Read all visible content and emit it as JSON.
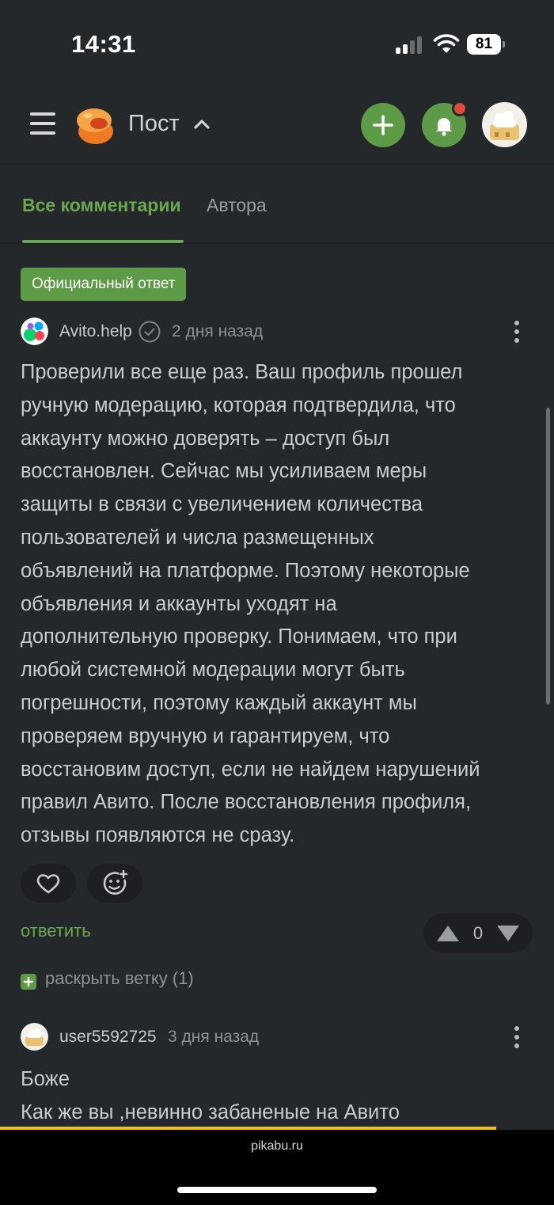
{
  "status_bar": {
    "time": "14:31",
    "battery": "81"
  },
  "header": {
    "title": "Пост"
  },
  "tabs": {
    "all": "Все комментарии",
    "author": "Автора"
  },
  "comment1": {
    "badge": "Официальный ответ",
    "author": "Avito.help",
    "time": "2 дня назад",
    "lines": [
      "Проверили все еще раз. Ваш профиль прошел",
      "ручную модерацию, которая подтвердила, что",
      "аккаунту можно доверять – доступ был",
      "восстановлен. Сейчас мы усиливаем меры",
      "защиты в связи с увеличением количества",
      "пользователей и числа размещенных",
      "объявлений на платформе. Поэтому некоторые",
      "объявления и аккаунты уходят на",
      "дополнительную проверку. Понимаем, что при",
      "любой системной модерации могут быть",
      "погрешности, поэтому каждый аккаунт мы",
      "проверяем вручную и гарантируем, что",
      "восстановим доступ, если не найдем нарушений",
      "правил Авито. После восстановления профиля,",
      "отзывы появляются не сразу."
    ],
    "reply": "ответить",
    "votes": "0",
    "expand": "раскрыть ветку (1)"
  },
  "comment2": {
    "author": "user5592725",
    "time": "3 дня назад",
    "lines": [
      "Боже",
      "Как же вы ,невинно забаненые на Авито"
    ]
  },
  "browser": {
    "url": "pikabu.ru"
  },
  "colors": {
    "accent": "#5e9b46",
    "link": "#6aa84f",
    "background": "#25282b",
    "notification": "#e24a3b"
  }
}
